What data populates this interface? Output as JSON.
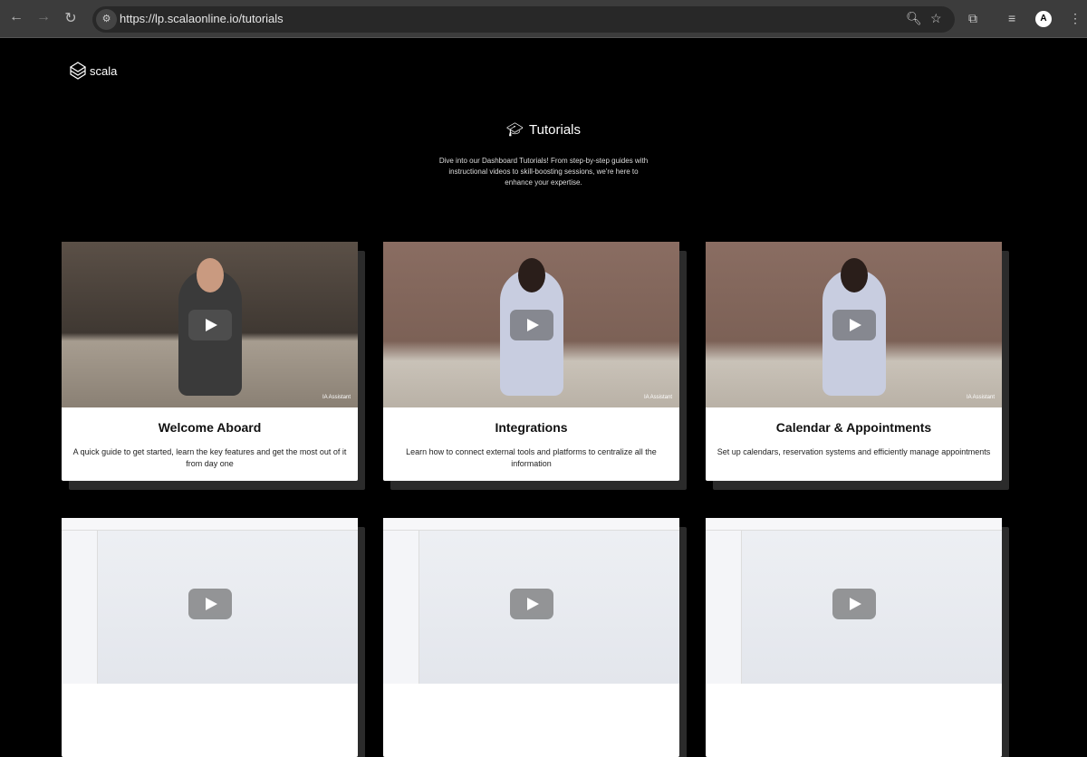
{
  "browser": {
    "url": "https://lp.scalaonline.io/tutorials",
    "avatar_letter": "A"
  },
  "brand": {
    "name": "scala"
  },
  "hero": {
    "title": "Tutorials",
    "description": "Dive into our Dashboard Tutorials! From step-by-step guides with instructional videos to skill-boosting sessions, we're here to enhance your expertise."
  },
  "cards": [
    {
      "title": "Welcome Aboard",
      "description": "A quick guide to get started, learn the key features and get the most out of it from day one",
      "badge": "IA Assistant"
    },
    {
      "title": "Integrations",
      "description": "Learn how to connect external tools and platforms to centralize all the information",
      "badge": "IA Assistant"
    },
    {
      "title": "Calendar & Appointments",
      "description": "Set up calendars, reservation systems and efficiently manage appointments",
      "badge": "IA Assistant"
    }
  ]
}
